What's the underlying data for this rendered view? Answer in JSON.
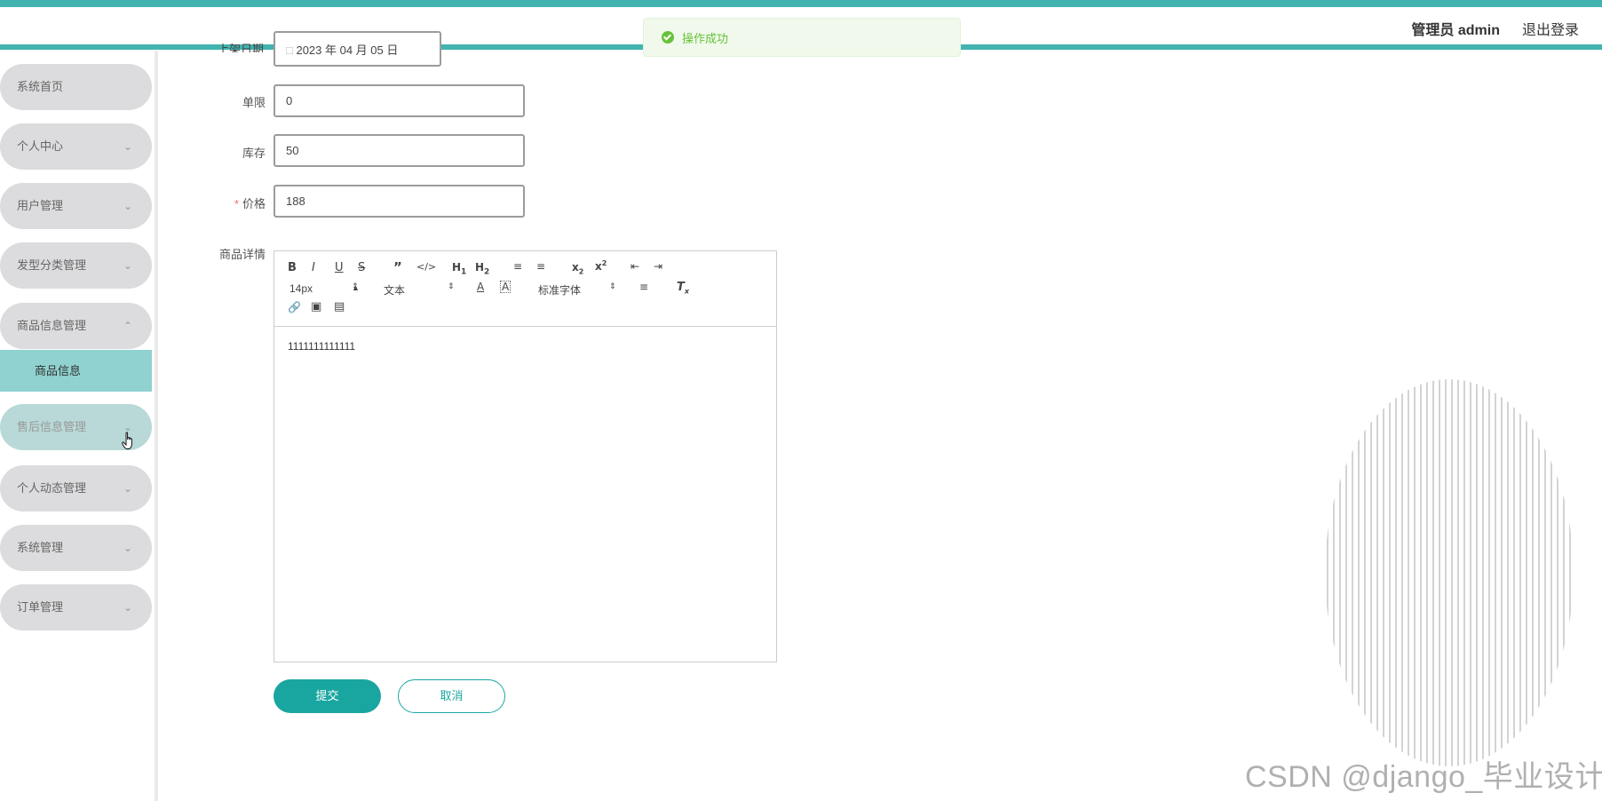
{
  "header": {
    "user_label": "管理员 admin",
    "logout_label": "退出登录"
  },
  "toast": {
    "message": "操作成功"
  },
  "sidebar": {
    "items": [
      {
        "label": "系统首页",
        "has_chevron": false
      },
      {
        "label": "个人中心",
        "has_chevron": true
      },
      {
        "label": "用户管理",
        "has_chevron": true
      },
      {
        "label": "发型分类管理",
        "has_chevron": true
      },
      {
        "label": "商品信息管理",
        "has_chevron": true,
        "expanded": true
      },
      {
        "label": "售后信息管理",
        "has_chevron": true,
        "hovered": true
      },
      {
        "label": "个人动态管理",
        "has_chevron": true
      },
      {
        "label": "系统管理",
        "has_chevron": true
      },
      {
        "label": "订单管理",
        "has_chevron": true
      }
    ],
    "submenu_active": "商品信息"
  },
  "form": {
    "date_partial_label": "上架日期",
    "date_value": "2023 年 04 月 05 日",
    "limit_label": "单限",
    "limit_value": "0",
    "stock_label": "库存",
    "stock_value": "50",
    "price_label": "价格",
    "price_value": "188",
    "detail_label": "商品详情"
  },
  "editor": {
    "font_size": "14px",
    "block_format": "文本",
    "font_family": "标准字体",
    "content": "1111111111111"
  },
  "actions": {
    "submit_label": "提交",
    "cancel_label": "取消"
  },
  "watermark": "CSDN @django_毕业设计",
  "colors": {
    "accent": "#41b4b0",
    "primary_button": "#1aa6a0",
    "menu_bg": "#dcdbdd",
    "active_sub": "#8fd2d0",
    "success": "#67c23a"
  }
}
